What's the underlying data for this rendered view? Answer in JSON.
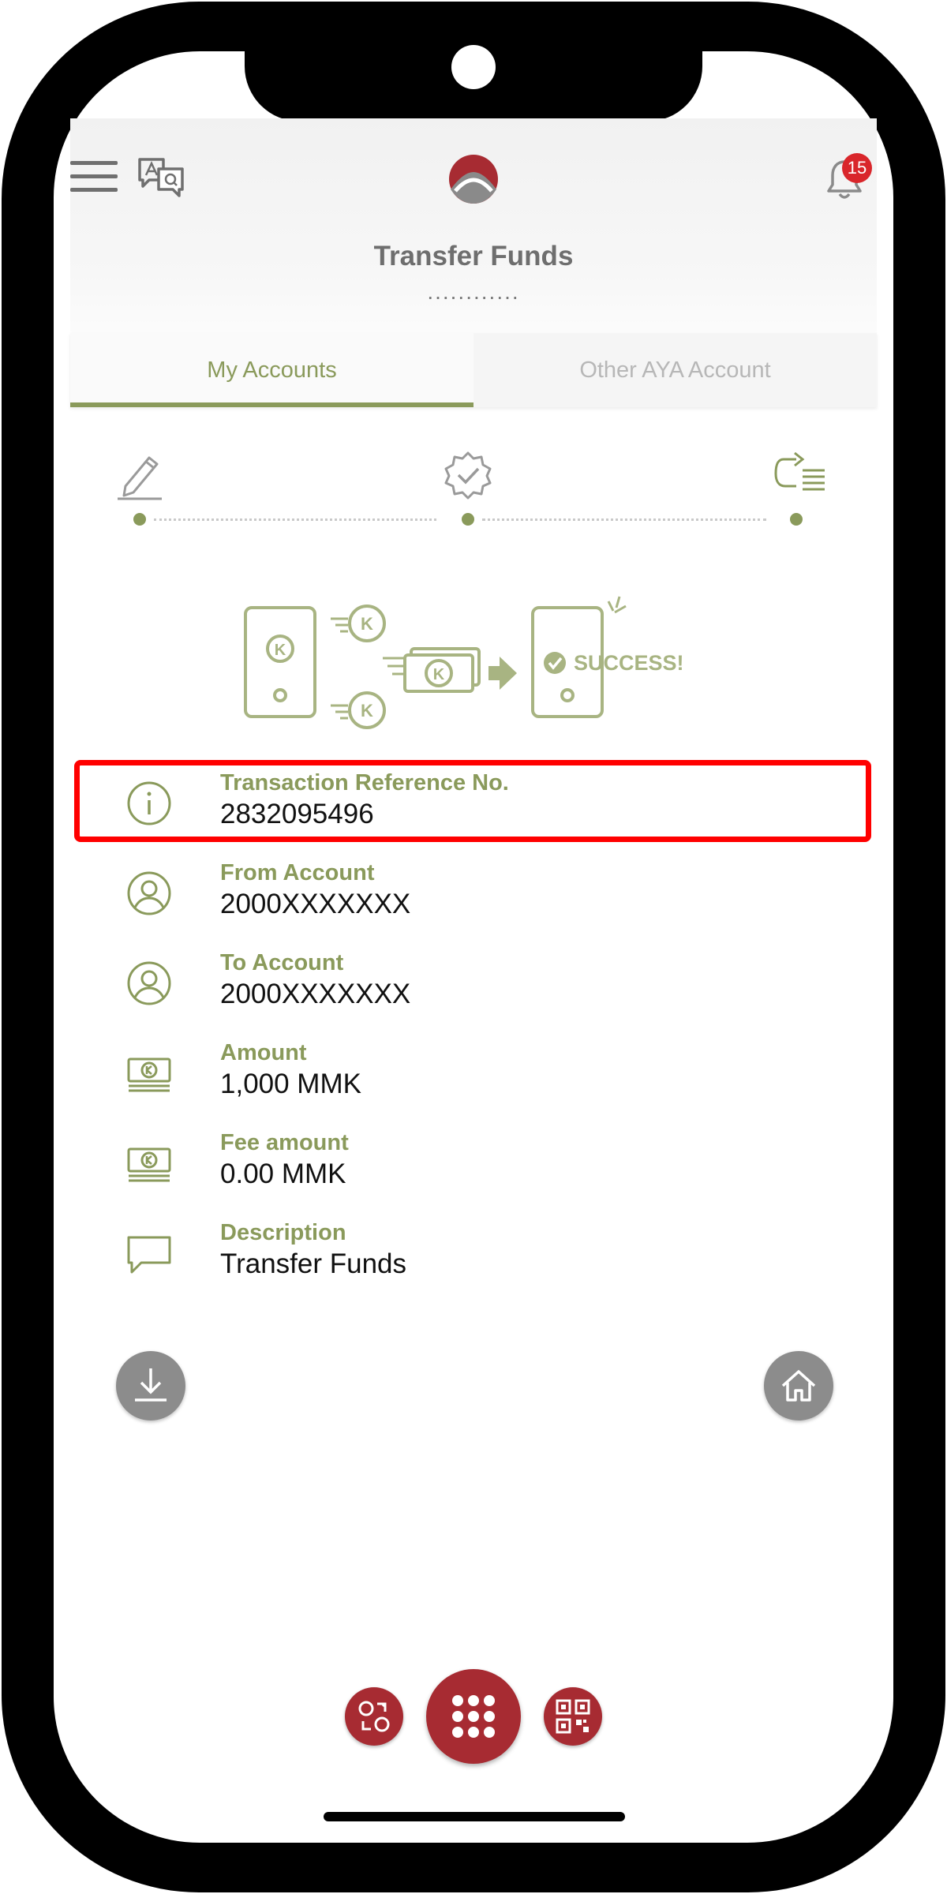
{
  "header": {
    "title": "Transfer Funds",
    "subtitle": "............",
    "notification_count": "15",
    "icons": {
      "menu": "hamburger-menu-icon",
      "language": "language-translate-icon",
      "logo": "aya-bank-logo",
      "bell": "bell-icon"
    }
  },
  "tabs": [
    {
      "label": "My Accounts",
      "active": true
    },
    {
      "label": "Other AYA Account",
      "active": false
    }
  ],
  "steps": [
    {
      "icon": "pencil-edit-icon",
      "status": "done"
    },
    {
      "icon": "verified-badge-icon",
      "status": "done"
    },
    {
      "icon": "transfer-complete-icon",
      "status": "current"
    }
  ],
  "illustration": {
    "success_text": "SUCCESS!",
    "kyat_symbol": "K"
  },
  "details": [
    {
      "label": "Transaction Reference No.",
      "value": "2832095496",
      "icon": "info-icon",
      "highlighted": true
    },
    {
      "label": "From Account",
      "value": "2000XXXXXXX",
      "icon": "user-circle-icon"
    },
    {
      "label": "To Account",
      "value": "2000XXXXXXX",
      "icon": "user-circle-icon"
    },
    {
      "label": "Amount",
      "value": "1,000 MMK",
      "icon": "kyat-banknote-icon"
    },
    {
      "label": "Fee amount",
      "value": "0.00 MMK",
      "icon": "kyat-banknote-icon"
    },
    {
      "label": "Description",
      "value": "Transfer Funds",
      "icon": "speech-bubble-icon"
    }
  ],
  "actions": {
    "download": "download-icon",
    "home": "home-icon"
  },
  "bottom_nav": {
    "left": "exchange-icon",
    "center": "grid-menu-icon",
    "right": "qr-code-icon"
  },
  "colors": {
    "accent": "#8a9a5b",
    "brand": "#a72b32",
    "highlight": "#ff0000",
    "badge": "#d9262b"
  }
}
